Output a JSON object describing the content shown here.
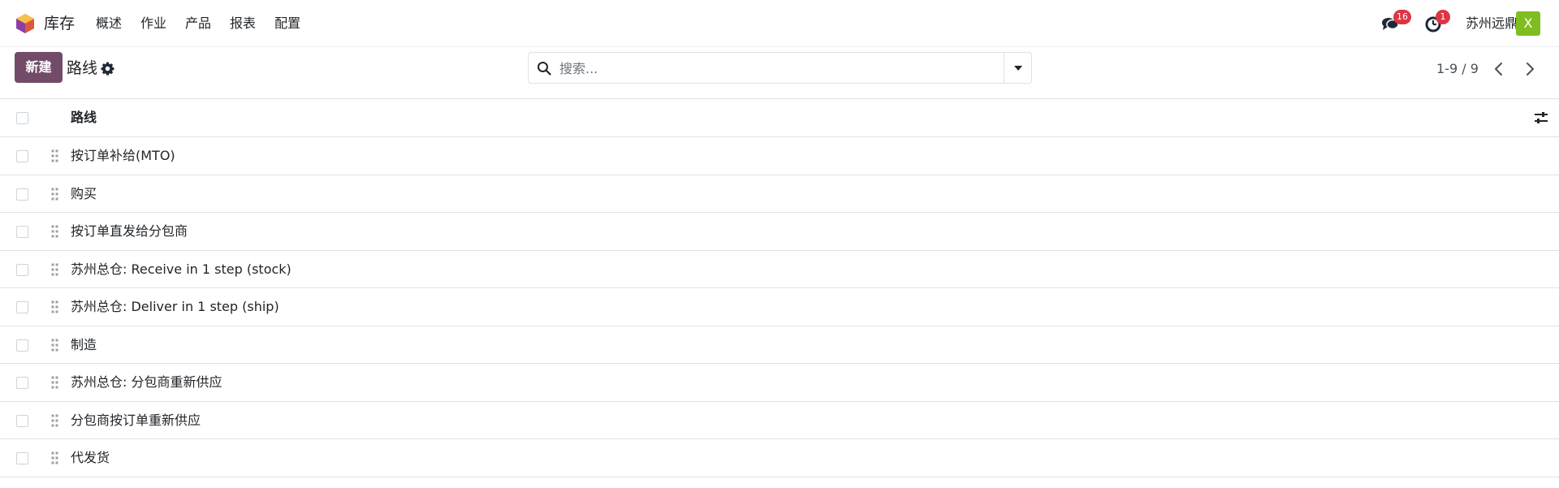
{
  "navbar": {
    "app_name": "库存",
    "menu": [
      "概述",
      "作业",
      "产品",
      "报表",
      "配置"
    ],
    "messages_count": "16",
    "activities_count": "1",
    "company": "苏州远鼎",
    "avatar_letter": "X"
  },
  "control_panel": {
    "new_label": "新建",
    "title": "路线",
    "search_placeholder": "搜索...",
    "pager": "1-9 / 9"
  },
  "list": {
    "column_header": "路线",
    "rows": [
      "按订单补给(MTO)",
      "购买",
      "按订单直发给分包商",
      "苏州总仓: Receive in 1 step (stock)",
      "苏州总仓: Deliver in 1 step (ship)",
      "制造",
      "苏州总仓: 分包商重新供应",
      "分包商按订单重新供应",
      "代发货"
    ]
  },
  "colors": {
    "brand": "#714b67",
    "badge": "#dc3545",
    "avatar": "#80bd21"
  }
}
